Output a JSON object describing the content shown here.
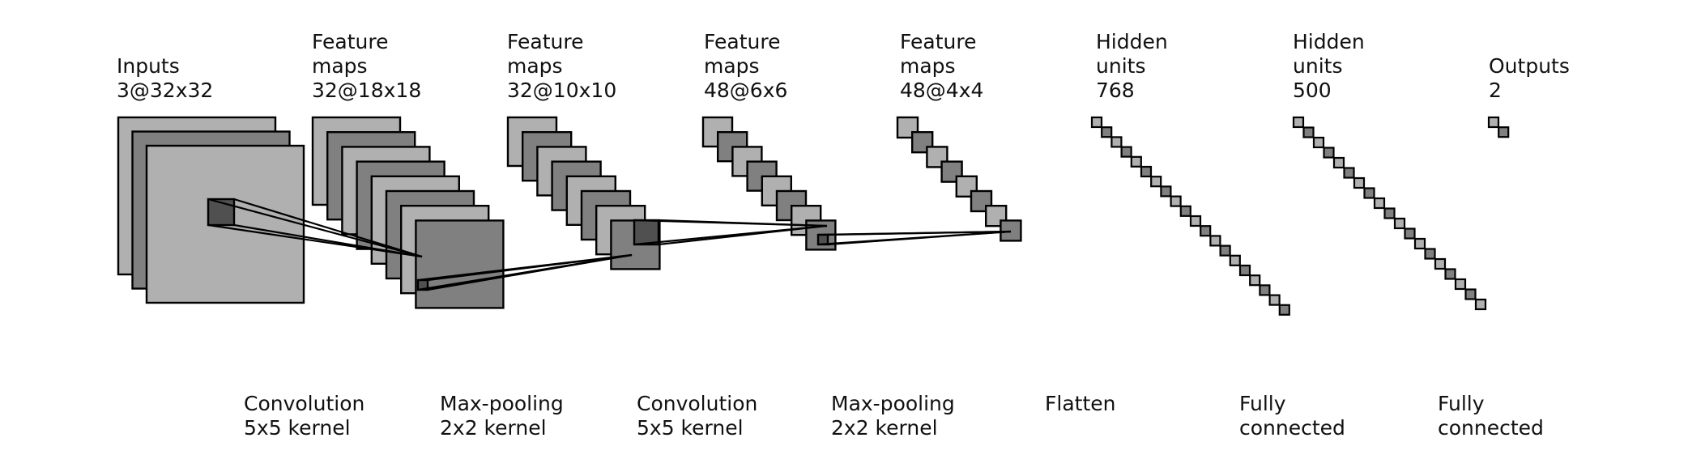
{
  "colors": {
    "light": "#b0b0b0",
    "mid": "#808080",
    "dark": "#505050",
    "edge": "#000000",
    "text": "#111111",
    "background": "#ffffff"
  },
  "top_labels": [
    {
      "lines": [
        "Inputs",
        "3@32x32"
      ]
    },
    {
      "lines": [
        "Feature",
        "maps",
        "32@18x18"
      ]
    },
    {
      "lines": [
        "Feature",
        "maps",
        "32@10x10"
      ]
    },
    {
      "lines": [
        "Feature",
        "maps",
        "48@6x6"
      ]
    },
    {
      "lines": [
        "Feature",
        "maps",
        "48@4x4"
      ]
    },
    {
      "lines": [
        "Hidden",
        "units",
        "768"
      ]
    },
    {
      "lines": [
        "Hidden",
        "units",
        "500"
      ]
    },
    {
      "lines": [
        "Outputs",
        "2"
      ]
    }
  ],
  "bottom_labels": [
    {
      "lines": [
        "Convolution",
        "5x5 kernel"
      ]
    },
    {
      "lines": [
        "Max-pooling",
        "2x2 kernel"
      ]
    },
    {
      "lines": [
        "Convolution",
        "5x5 kernel"
      ]
    },
    {
      "lines": [
        "Max-pooling",
        "2x2 kernel"
      ]
    },
    {
      "lines": [
        "Flatten"
      ]
    },
    {
      "lines": [
        "Fully",
        "connected"
      ]
    },
    {
      "lines": [
        "Fully",
        "connected"
      ]
    }
  ],
  "layers": [
    {
      "name": "inputs",
      "kind": "conv",
      "channels": 3,
      "spatial": 32,
      "drawn_maps": 3
    },
    {
      "name": "feature-maps-1",
      "kind": "conv",
      "channels": 32,
      "spatial": 18,
      "drawn_maps": 8
    },
    {
      "name": "feature-maps-2",
      "kind": "conv",
      "channels": 32,
      "spatial": 10,
      "drawn_maps": 8
    },
    {
      "name": "feature-maps-3",
      "kind": "conv",
      "channels": 48,
      "spatial": 6,
      "drawn_maps": 8
    },
    {
      "name": "feature-maps-4",
      "kind": "conv",
      "channels": 48,
      "spatial": 4,
      "drawn_maps": 8
    },
    {
      "name": "hidden-units-1",
      "kind": "fc",
      "units": 768,
      "drawn_units": 20
    },
    {
      "name": "hidden-units-2",
      "kind": "fc",
      "units": 500,
      "drawn_units": 19
    },
    {
      "name": "outputs",
      "kind": "fc",
      "units": 2,
      "drawn_units": 2
    }
  ],
  "operations": [
    {
      "name": "convolution-1",
      "type": "Convolution",
      "kernel": "5x5"
    },
    {
      "name": "max-pooling-1",
      "type": "Max-pooling",
      "kernel": "2x2"
    },
    {
      "name": "convolution-2",
      "type": "Convolution",
      "kernel": "5x5"
    },
    {
      "name": "max-pooling-2",
      "type": "Max-pooling",
      "kernel": "2x2"
    },
    {
      "name": "flatten",
      "type": "Flatten"
    },
    {
      "name": "fully-connected-1",
      "type": "Fully connected"
    },
    {
      "name": "fully-connected-2",
      "type": "Fully connected"
    }
  ]
}
